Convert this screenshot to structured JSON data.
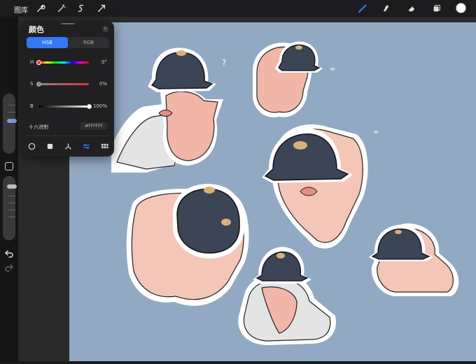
{
  "topbar": {
    "gallery_label": "图库",
    "left_tools": [
      "wrench-icon",
      "magic-wand-icon",
      "selection-icon",
      "transform-arrow-icon"
    ],
    "right_tools": [
      "brush-icon",
      "smudge-icon",
      "eraser-icon",
      "layers-icon"
    ],
    "current_color": "#FFFFFF",
    "accent": "#3478F6"
  },
  "color_panel": {
    "title": "颜色",
    "tabs": [
      {
        "label": "HSB",
        "active": true
      },
      {
        "label": "RGB",
        "active": false
      }
    ],
    "sliders": [
      {
        "label": "H",
        "value": "0°",
        "fraction": 0.0
      },
      {
        "label": "S",
        "value": "0%",
        "fraction": 0.0
      },
      {
        "label": "B",
        "value": "100%",
        "fraction": 1.0
      }
    ],
    "hex": {
      "label": "十六进制",
      "value": "#FFFFFF"
    },
    "modes": [
      "disc-icon",
      "classic-square-icon",
      "harmony-icon",
      "value-sliders-icon",
      "palette-grid-icon"
    ],
    "active_mode": 3
  },
  "sidebar": {
    "size_level": 0.55,
    "opacity_level": 0.85
  },
  "canvas": {
    "background": "#92A9C3",
    "stickers": [
      "pig-held-in-hand",
      "pig-sleeping",
      "pig-back-view-large",
      "pig-front-helmet-large",
      "pig-hug",
      "pig-side-small"
    ]
  }
}
